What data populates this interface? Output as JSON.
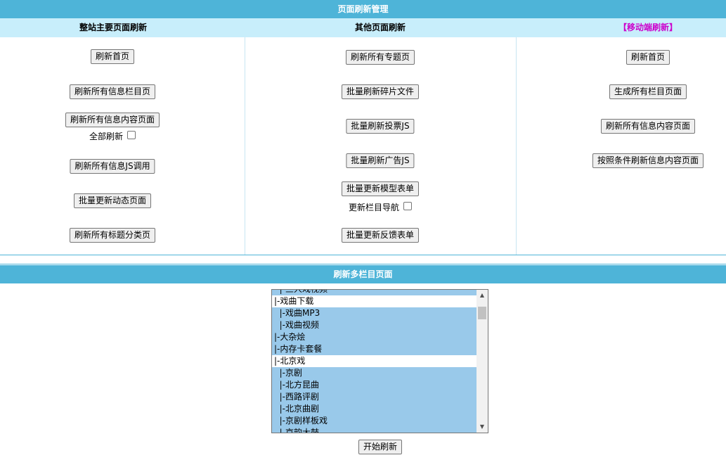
{
  "header": {
    "title": "页面刷新管理"
  },
  "columns": {
    "main": {
      "heading": "整站主要页面刷新",
      "buttons": [
        "刷新首页",
        "刷新所有信息栏目页",
        "刷新所有信息内容页面",
        "刷新所有信息JS调用",
        "批量更新动态页面",
        "刷新所有标题分类页"
      ],
      "checkbox_label": "全部刷新"
    },
    "other": {
      "heading": "其他页面刷新",
      "buttons": [
        "刷新所有专题页",
        "批量刷新碎片文件",
        "批量刷新投票JS",
        "批量刷新广告JS",
        "批量更新模型表单",
        "批量更新反馈表单"
      ],
      "checkbox_label": "更新栏目导航"
    },
    "mobile": {
      "heading": "【移动端刷新】",
      "heading_color": "#cc00cc",
      "buttons": [
        "刷新首页",
        "生成所有栏目页面",
        "刷新所有信息内容页面",
        "按照条件刷新信息内容页面"
      ]
    }
  },
  "multi": {
    "title": "刷新多栏目页面",
    "options": [
      {
        "label": "  |-三人戏视频",
        "selected": true
      },
      {
        "label": "|-戏曲下载",
        "selected": false
      },
      {
        "label": "  |-戏曲MP3",
        "selected": true
      },
      {
        "label": "  |-戏曲视频",
        "selected": true
      },
      {
        "label": "|-大杂烩",
        "selected": true
      },
      {
        "label": "|-内存卡套餐",
        "selected": true
      },
      {
        "label": "|-北京戏",
        "selected": false
      },
      {
        "label": "  |-京剧",
        "selected": true
      },
      {
        "label": "  |-北方昆曲",
        "selected": true
      },
      {
        "label": "  |-西路评剧",
        "selected": true
      },
      {
        "label": "  |-北京曲剧",
        "selected": true
      },
      {
        "label": "  |-京剧样板戏",
        "selected": true
      },
      {
        "label": "  |-京韵大鼓",
        "selected": true
      }
    ],
    "start_button": "开始刷新"
  },
  "colors": {
    "header_bg": "#4eb4d8",
    "subhead_bg": "#c8eefb",
    "selected_option_bg": "#99c9ea"
  }
}
